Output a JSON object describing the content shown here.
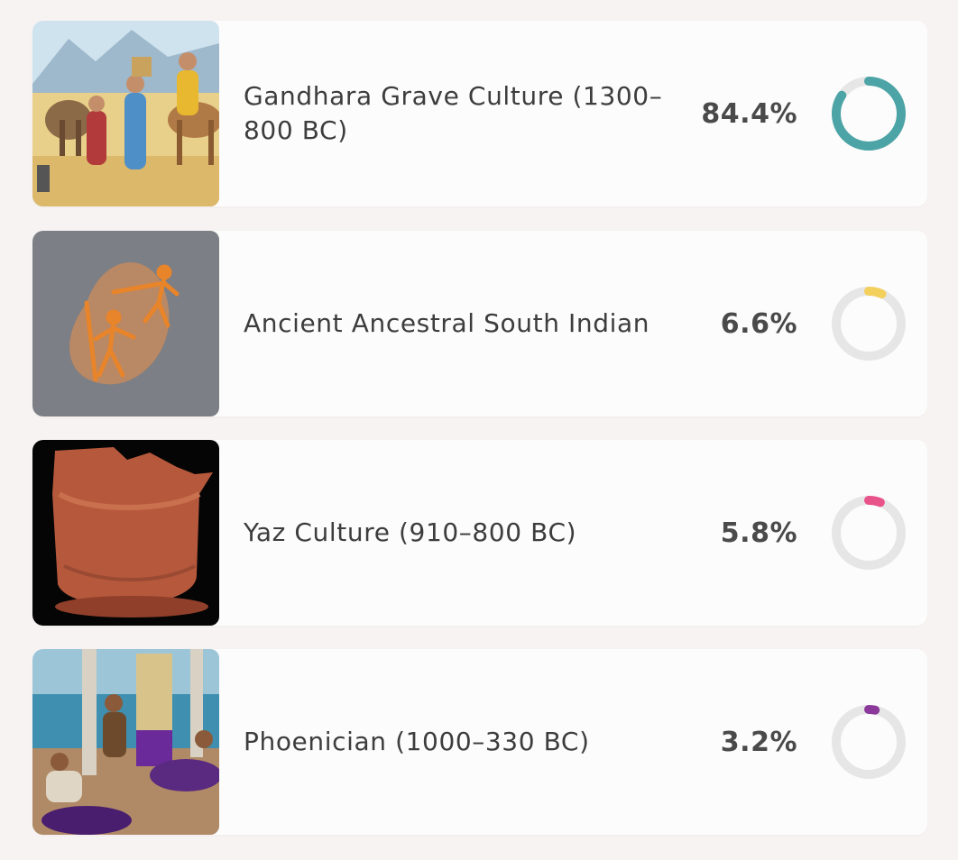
{
  "items": [
    {
      "name": "Gandhara Grave Culture (1300–800 BC)",
      "percent": "84.4%",
      "fraction": 0.844,
      "color": "#4ca4a6",
      "image": "caravan-illustration"
    },
    {
      "name": "Ancient Ancestral South Indian",
      "percent": "6.6%",
      "fraction": 0.066,
      "color": "#f3cf5c",
      "image": "rock-art-hunters"
    },
    {
      "name": "Yaz Culture (910–800 BC)",
      "percent": "5.8%",
      "fraction": 0.058,
      "color": "#e8538a",
      "image": "clay-pot"
    },
    {
      "name": "Phoenician (1000–330 BC)",
      "percent": "3.2%",
      "fraction": 0.032,
      "color": "#8b3a9b",
      "image": "purple-dye-workers"
    }
  ],
  "colors": {
    "track": "#e6e6e6",
    "card": "#fdfcfc",
    "background": "#f7f3f2"
  }
}
